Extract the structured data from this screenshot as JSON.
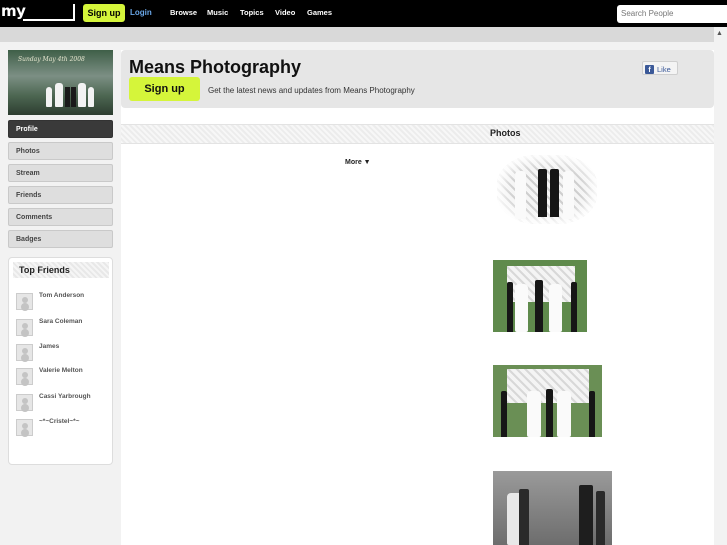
{
  "topbar": {
    "logo": "my",
    "signup_label": "Sign up",
    "login_label": "Login",
    "nav": [
      "Browse",
      "Music",
      "Topics",
      "Video",
      "Games"
    ],
    "search_placeholder": "Search People"
  },
  "profile_image": {
    "caption": "Sunday May 4th 2008"
  },
  "sidebar": {
    "items": [
      {
        "label": "Profile",
        "active": true
      },
      {
        "label": "Photos",
        "active": false
      },
      {
        "label": "Stream",
        "active": false
      },
      {
        "label": "Friends",
        "active": false
      },
      {
        "label": "Comments",
        "active": false
      },
      {
        "label": "Badges",
        "active": false
      }
    ]
  },
  "top_friends": {
    "title": "Top Friends",
    "friends": [
      "Tom Anderson",
      "Sara Coleman",
      "James",
      "Valerie Melton",
      "Cassi Yarbrough",
      "~*~Cristel~*~"
    ]
  },
  "header": {
    "title": "Means Photography",
    "signup_label": "Sign up",
    "tagline": "Get the latest news and updates from Means Photography",
    "like_label": "Like"
  },
  "photos": {
    "title": "Photos",
    "more_label": "More ▼"
  },
  "colors": {
    "accent": "#d5f53a",
    "topbar": "#000000",
    "facebook": "#3b5998"
  }
}
